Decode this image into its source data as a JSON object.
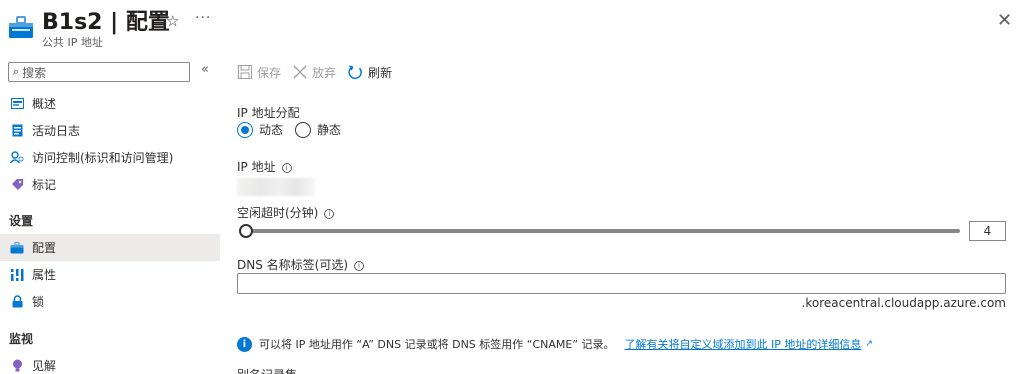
{
  "header": {
    "title": "B1s2 | 配置",
    "subtitle": "公共 IP 地址",
    "icon": "public-ip-icon",
    "more": "···",
    "close": "✕"
  },
  "sidebar": {
    "search_placeholder": "搜索",
    "items_top": [
      {
        "label": "概述",
        "icon": "overview-icon"
      },
      {
        "label": "活动日志",
        "icon": "activity-log-icon"
      },
      {
        "label": "访问控制(标识和访问管理)",
        "icon": "access-control-icon"
      },
      {
        "label": "标记",
        "icon": "tag-icon"
      }
    ],
    "section_settings": "设置",
    "items_settings": [
      {
        "label": "配置",
        "icon": "configuration-icon",
        "selected": true
      },
      {
        "label": "属性",
        "icon": "properties-icon"
      },
      {
        "label": "锁",
        "icon": "lock-icon"
      }
    ],
    "section_monitoring": "监视",
    "items_monitoring": [
      {
        "label": "见解",
        "icon": "insights-icon"
      }
    ]
  },
  "toolbar": {
    "save_label": "保存",
    "discard_label": "放弃",
    "refresh_label": "刷新"
  },
  "form": {
    "ip_assignment_label": "IP 地址分配",
    "dynamic_label": "动态",
    "static_label": "静态",
    "selected_assignment": "动态",
    "ip_address_label": "IP 地址",
    "idle_timeout_label": "空闲超时(分钟)",
    "idle_timeout_value": "4",
    "idle_timeout_fraction": 0.0,
    "dns_label": "DNS 名称标签(可选)",
    "dns_value": "",
    "dns_suffix": ".koreacentral.cloudapp.azure.com",
    "info_text": "可以将 IP 地址用作 “A” DNS 记录或将 DNS 标签用作 “CNAME” 记录。",
    "info_link": "了解有关将自定义域添加到此 IP 地址的详细信息",
    "alias_label": "别名记录集"
  },
  "colors": {
    "accent": "#0078d4",
    "selected_bg": "#edebe9",
    "disabled_text": "#a19f9d"
  }
}
